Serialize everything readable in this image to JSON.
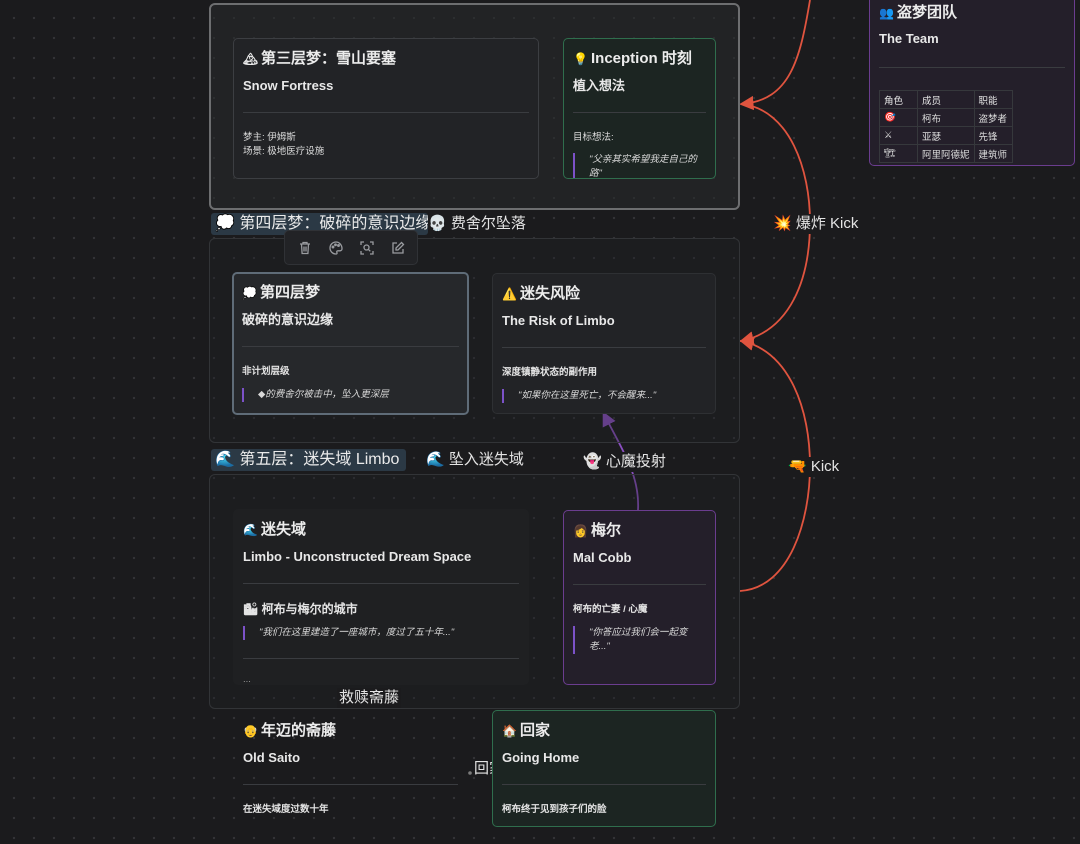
{
  "edge_labels": {
    "kick1": "💥 爆炸 Kick",
    "kick2": "🔫 Kick",
    "fall": "💀 费舍尔坠落",
    "limbo_drop": "🌊 坠入迷失域",
    "projection": "👻 心魔投射",
    "redeem": "救赎斋藤",
    "go_home": "回家"
  },
  "team": {
    "title": "盗梦团队",
    "subtitle": "The Team",
    "headers": [
      "角色",
      "成员",
      "职能"
    ],
    "rows": [
      {
        "icon": "🎯",
        "member": "柯布",
        "role": "盗梦者"
      },
      {
        "icon": "⚔",
        "member": "亚瑟",
        "role": "先锋"
      },
      {
        "icon": "🏗",
        "member": "阿里阿德妮",
        "role": "建筑师"
      }
    ]
  },
  "level3": {
    "fortress": {
      "icon": "🏔",
      "title": "第三层梦：雪山要塞",
      "subtitle": "Snow Fortress",
      "dreamer": "梦主: 伊姆斯",
      "scene": "场景: 极地医疗设施"
    },
    "inception": {
      "icon": "💡",
      "title": "Inception 时刻",
      "subtitle": "植入想法",
      "label": "目标想法:",
      "quote": "\"父亲其实希望我走自己的路\""
    }
  },
  "level4": {
    "group_label": "💭 第四层梦：破碎的意识边缘",
    "dream": {
      "icon": "💭",
      "title": "第四层梦",
      "subtitle": "破碎的意识边缘",
      "label": "非计划层级",
      "quote": "◆的费舍尔被击中，坠入更深层"
    },
    "risk": {
      "icon": "⚠️",
      "title": "迷失风险",
      "subtitle": "The Risk of Limbo",
      "label": "深度镇静状态的副作用",
      "quote": "\"如果你在这里死亡，不会醒来...\""
    }
  },
  "level5": {
    "group_label": "🌊 第五层：迷失域 Limbo",
    "limbo": {
      "icon": "🌊",
      "title": "迷失域",
      "subtitle": "Limbo - Unconstructed Dream Space",
      "city_heading": "🏙 柯布与梅尔的城市",
      "quote": "\"我们在这里建造了一座城市，度过了五十年...\"",
      "trailing": "..."
    },
    "mal": {
      "icon": "👩",
      "title": "梅尔",
      "subtitle": "Mal Cobb",
      "label": "柯布的亡妻 / 心魔",
      "quote": "\"你答应过我们会一起变老...\""
    }
  },
  "saito": {
    "icon": "👴",
    "title": "年迈的斋藤",
    "subtitle": "Old Saito",
    "label": "在迷失域度过数十年"
  },
  "home": {
    "icon": "🏠",
    "title": "回家",
    "subtitle": "Going Home",
    "label": "柯布终于见到孩子们的脸"
  },
  "toolbar": {
    "delete": "delete",
    "color": "color",
    "zoom": "zoom",
    "edit": "edit"
  },
  "colors": {
    "kick_edge": "#e0543f",
    "projection_edge": "#8a4fc0",
    "green_border": "#2f6e4d",
    "purple_border": "#6b3d8f"
  }
}
